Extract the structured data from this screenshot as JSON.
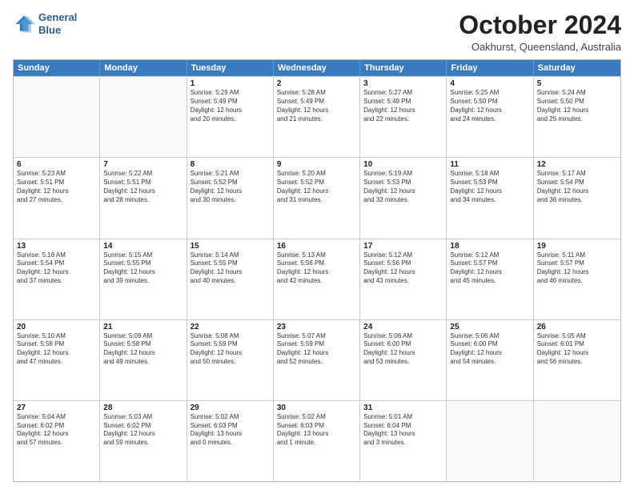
{
  "header": {
    "logo_line1": "General",
    "logo_line2": "Blue",
    "month": "October 2024",
    "location": "Oakhurst, Queensland, Australia"
  },
  "weekdays": [
    "Sunday",
    "Monday",
    "Tuesday",
    "Wednesday",
    "Thursday",
    "Friday",
    "Saturday"
  ],
  "rows": [
    [
      {
        "day": "",
        "lines": []
      },
      {
        "day": "",
        "lines": []
      },
      {
        "day": "1",
        "lines": [
          "Sunrise: 5:29 AM",
          "Sunset: 5:49 PM",
          "Daylight: 12 hours",
          "and 20 minutes."
        ]
      },
      {
        "day": "2",
        "lines": [
          "Sunrise: 5:28 AM",
          "Sunset: 5:49 PM",
          "Daylight: 12 hours",
          "and 21 minutes."
        ]
      },
      {
        "day": "3",
        "lines": [
          "Sunrise: 5:27 AM",
          "Sunset: 5:49 PM",
          "Daylight: 12 hours",
          "and 22 minutes."
        ]
      },
      {
        "day": "4",
        "lines": [
          "Sunrise: 5:25 AM",
          "Sunset: 5:50 PM",
          "Daylight: 12 hours",
          "and 24 minutes."
        ]
      },
      {
        "day": "5",
        "lines": [
          "Sunrise: 5:24 AM",
          "Sunset: 5:50 PM",
          "Daylight: 12 hours",
          "and 25 minutes."
        ]
      }
    ],
    [
      {
        "day": "6",
        "lines": [
          "Sunrise: 5:23 AM",
          "Sunset: 5:51 PM",
          "Daylight: 12 hours",
          "and 27 minutes."
        ]
      },
      {
        "day": "7",
        "lines": [
          "Sunrise: 5:22 AM",
          "Sunset: 5:51 PM",
          "Daylight: 12 hours",
          "and 28 minutes."
        ]
      },
      {
        "day": "8",
        "lines": [
          "Sunrise: 5:21 AM",
          "Sunset: 5:52 PM",
          "Daylight: 12 hours",
          "and 30 minutes."
        ]
      },
      {
        "day": "9",
        "lines": [
          "Sunrise: 5:20 AM",
          "Sunset: 5:52 PM",
          "Daylight: 12 hours",
          "and 31 minutes."
        ]
      },
      {
        "day": "10",
        "lines": [
          "Sunrise: 5:19 AM",
          "Sunset: 5:53 PM",
          "Daylight: 12 hours",
          "and 33 minutes."
        ]
      },
      {
        "day": "11",
        "lines": [
          "Sunrise: 5:18 AM",
          "Sunset: 5:53 PM",
          "Daylight: 12 hours",
          "and 34 minutes."
        ]
      },
      {
        "day": "12",
        "lines": [
          "Sunrise: 5:17 AM",
          "Sunset: 5:54 PM",
          "Daylight: 12 hours",
          "and 36 minutes."
        ]
      }
    ],
    [
      {
        "day": "13",
        "lines": [
          "Sunrise: 5:16 AM",
          "Sunset: 5:54 PM",
          "Daylight: 12 hours",
          "and 37 minutes."
        ]
      },
      {
        "day": "14",
        "lines": [
          "Sunrise: 5:15 AM",
          "Sunset: 5:55 PM",
          "Daylight: 12 hours",
          "and 39 minutes."
        ]
      },
      {
        "day": "15",
        "lines": [
          "Sunrise: 5:14 AM",
          "Sunset: 5:55 PM",
          "Daylight: 12 hours",
          "and 40 minutes."
        ]
      },
      {
        "day": "16",
        "lines": [
          "Sunrise: 5:13 AM",
          "Sunset: 5:56 PM",
          "Daylight: 12 hours",
          "and 42 minutes."
        ]
      },
      {
        "day": "17",
        "lines": [
          "Sunrise: 5:12 AM",
          "Sunset: 5:56 PM",
          "Daylight: 12 hours",
          "and 43 minutes."
        ]
      },
      {
        "day": "18",
        "lines": [
          "Sunrise: 5:12 AM",
          "Sunset: 5:57 PM",
          "Daylight: 12 hours",
          "and 45 minutes."
        ]
      },
      {
        "day": "19",
        "lines": [
          "Sunrise: 5:11 AM",
          "Sunset: 5:57 PM",
          "Daylight: 12 hours",
          "and 46 minutes."
        ]
      }
    ],
    [
      {
        "day": "20",
        "lines": [
          "Sunrise: 5:10 AM",
          "Sunset: 5:58 PM",
          "Daylight: 12 hours",
          "and 47 minutes."
        ]
      },
      {
        "day": "21",
        "lines": [
          "Sunrise: 5:09 AM",
          "Sunset: 5:58 PM",
          "Daylight: 12 hours",
          "and 49 minutes."
        ]
      },
      {
        "day": "22",
        "lines": [
          "Sunrise: 5:08 AM",
          "Sunset: 5:59 PM",
          "Daylight: 12 hours",
          "and 50 minutes."
        ]
      },
      {
        "day": "23",
        "lines": [
          "Sunrise: 5:07 AM",
          "Sunset: 5:59 PM",
          "Daylight: 12 hours",
          "and 52 minutes."
        ]
      },
      {
        "day": "24",
        "lines": [
          "Sunrise: 5:06 AM",
          "Sunset: 6:00 PM",
          "Daylight: 12 hours",
          "and 53 minutes."
        ]
      },
      {
        "day": "25",
        "lines": [
          "Sunrise: 5:06 AM",
          "Sunset: 6:00 PM",
          "Daylight: 12 hours",
          "and 54 minutes."
        ]
      },
      {
        "day": "26",
        "lines": [
          "Sunrise: 5:05 AM",
          "Sunset: 6:01 PM",
          "Daylight: 12 hours",
          "and 56 minutes."
        ]
      }
    ],
    [
      {
        "day": "27",
        "lines": [
          "Sunrise: 5:04 AM",
          "Sunset: 6:02 PM",
          "Daylight: 12 hours",
          "and 57 minutes."
        ]
      },
      {
        "day": "28",
        "lines": [
          "Sunrise: 5:03 AM",
          "Sunset: 6:02 PM",
          "Daylight: 12 hours",
          "and 59 minutes."
        ]
      },
      {
        "day": "29",
        "lines": [
          "Sunrise: 5:02 AM",
          "Sunset: 6:03 PM",
          "Daylight: 13 hours",
          "and 0 minutes."
        ]
      },
      {
        "day": "30",
        "lines": [
          "Sunrise: 5:02 AM",
          "Sunset: 6:03 PM",
          "Daylight: 13 hours",
          "and 1 minute."
        ]
      },
      {
        "day": "31",
        "lines": [
          "Sunrise: 5:01 AM",
          "Sunset: 6:04 PM",
          "Daylight: 13 hours",
          "and 3 minutes."
        ]
      },
      {
        "day": "",
        "lines": []
      },
      {
        "day": "",
        "lines": []
      }
    ]
  ]
}
